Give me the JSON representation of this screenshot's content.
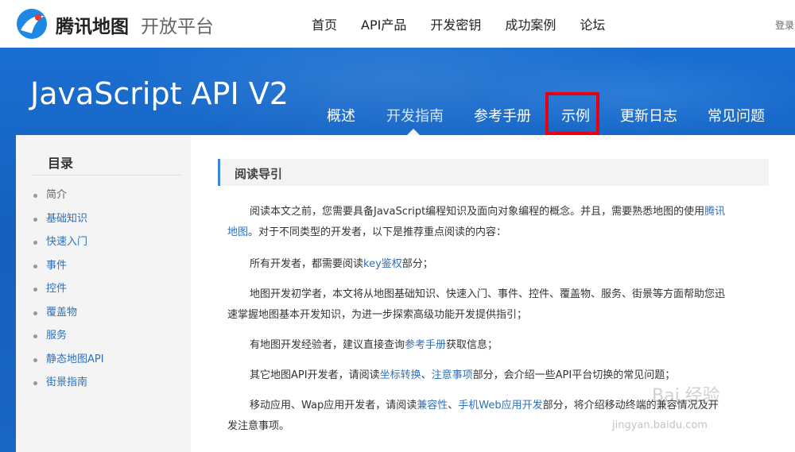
{
  "topbar": {
    "brand_name": "腾讯地图",
    "brand_sub": "开放平台",
    "nav": [
      "首页",
      "API产品",
      "开发密钥",
      "成功案例",
      "论坛"
    ],
    "login": "登录"
  },
  "banner": {
    "title": "JavaScript API V2",
    "tabs": [
      "概述",
      "开发指南",
      "参考手册",
      "示例",
      "更新日志",
      "常见问题"
    ],
    "active_tab": "开发指南",
    "highlighted_tab": "示例",
    "highlight_color": "#e60012",
    "background_color": "#1763c2"
  },
  "sidebar": {
    "title": "目录",
    "items": [
      "简介",
      "基础知识",
      "快速入门",
      "事件",
      "控件",
      "覆盖物",
      "服务",
      "静态地图API",
      "街景指南"
    ]
  },
  "main": {
    "section_title": "阅读导引",
    "p1_a": "阅读本文之前，您需要具备JavaScript编程知识及面向对象编程的概念。并且，需要熟悉地图的使用",
    "p1_link": "腾讯",
    "p1_b_link": "地图",
    "p1_c": "。对于不同类型的开发者，以下是推荐重点阅读的内容：",
    "p2_a": "所有开发者，都需要阅读",
    "p2_link": "key鉴权",
    "p2_b": "部分；",
    "p3_a": "地图开发初学者，本文将从地图基础知识、快速入门、事件、控件、覆盖物、服务、街景等方面帮助您迅",
    "p3_b": "速掌握地图基本开发知识，为进一步探索高级功能开发提供指引；",
    "p4_a": "有地图开发经验者，建议直接查询",
    "p4_link": "参考手册",
    "p4_b": "获取信息；",
    "p5_a": "其它地图API开发者，请阅读",
    "p5_link1": "坐标转换",
    "p5_sep": "、",
    "p5_link2": "注意事项",
    "p5_b": "部分，会介绍一些API平台切换的常见问题；",
    "p6_a": "移动应用、Wap应用开发者，请阅读",
    "p6_link1": "兼容性",
    "p6_sep": "、",
    "p6_link2": "手机Web应用开发",
    "p6_b": "部分，将介绍移动终端的兼容情况及开",
    "p6_c": "发注意事项。"
  },
  "watermark": {
    "brand": "Bai 经验",
    "url": "jingyan.baidu.com"
  }
}
